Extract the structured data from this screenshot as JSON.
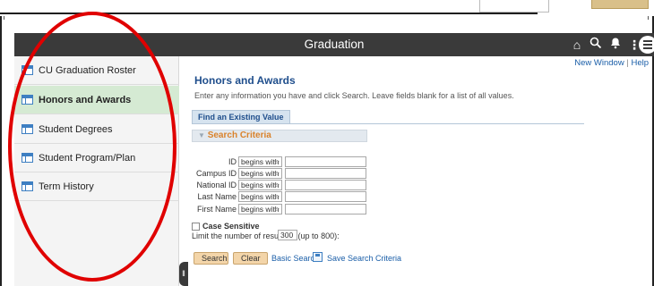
{
  "header": {
    "title": "Graduation"
  },
  "icons": {
    "home": "home-icon",
    "search": "search-icon",
    "bell": "notification-bell-icon",
    "more": "more-actions-icon",
    "menu": "nav-menu-icon"
  },
  "sidebar": {
    "items": [
      {
        "label": "CU Graduation Roster",
        "active": false
      },
      {
        "label": "Honors and Awards",
        "active": true
      },
      {
        "label": "Student Degrees",
        "active": false
      },
      {
        "label": "Student Program/Plan",
        "active": false
      },
      {
        "label": "Term History",
        "active": false
      }
    ]
  },
  "top_links": {
    "new_window": "New Window",
    "separator": "|",
    "help": "Help"
  },
  "main": {
    "title": "Honors and Awards",
    "instructions": "Enter any information you have and click Search. Leave fields blank for a list of all values.",
    "tab": "Find an Existing Value",
    "section": "Search Criteria",
    "fields": [
      {
        "label": "ID",
        "operator": "begins with",
        "value": ""
      },
      {
        "label": "Campus ID",
        "operator": "begins with",
        "value": ""
      },
      {
        "label": "National ID",
        "operator": "begins with",
        "value": ""
      },
      {
        "label": "Last Name",
        "operator": "begins with",
        "value": ""
      },
      {
        "label": "First Name",
        "operator": "begins with",
        "value": ""
      }
    ],
    "case_sensitive": {
      "label": "Case Sensitive",
      "checked": false
    },
    "limit": {
      "label": "Limit the number of results to (up to 800):",
      "value": "300"
    },
    "buttons": {
      "search": "Search",
      "clear": "Clear"
    },
    "links": {
      "basic_search": "Basic Search",
      "save_criteria": "Save Search Criteria"
    }
  },
  "colors": {
    "header_bg": "#3a3a3a",
    "active_nav": "#d5ead3",
    "annotation": "#e00000",
    "button": "#f3d5a9",
    "link": "#1a5ea8",
    "section_title": "#d9822b"
  }
}
